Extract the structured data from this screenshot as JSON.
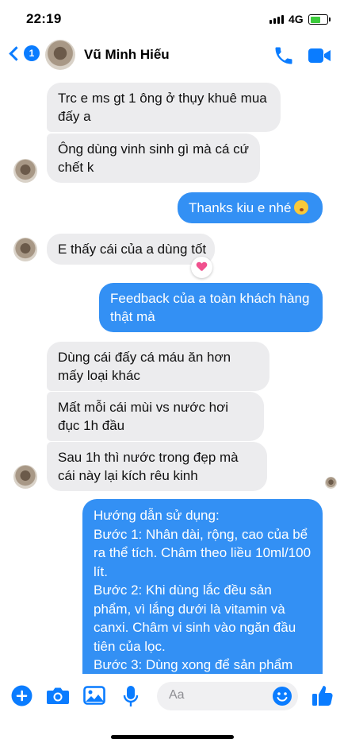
{
  "status": {
    "time": "22:19",
    "network": "4G"
  },
  "header": {
    "back_count": "1",
    "contact_name": "Vũ Minh Hiếu"
  },
  "messages": [
    {
      "dir": "in",
      "text": "Trc e ms gt 1 ông ở  thụy khuê mua đấy a"
    },
    {
      "dir": "in",
      "text": "Ông dùng vinh sinh gì mà cá cứ chết k"
    },
    {
      "dir": "out",
      "text": "Thanks kiu e nhé"
    },
    {
      "dir": "in",
      "text": "E thấy cái của a dùng tốt"
    },
    {
      "dir": "out",
      "text": "Feedback của a toàn khách hàng thật mà"
    },
    {
      "dir": "in",
      "text": "Dùng cái đấy cá máu ăn hơn mấy loại khác"
    },
    {
      "dir": "in",
      "text": "Mất mỗi cái mùi vs nước hơi đục 1h đầu"
    },
    {
      "dir": "in",
      "text": "Sau 1h thì nước trong đẹp mà cái này lại kích rêu kinh"
    },
    {
      "dir": "out",
      "lines": [
        "Hướng dẫn sử dụng:",
        "Bước 1: Nhân dài, rộng, cao của bể ra thể tích. Châm theo liều 10ml/100 lít.",
        "Bước 2: Khi dùng lắc đều sản phẩm, vì lắng dưới là vitamin và canxi. Châm vi sinh vào ngăn đầu tiên của lọc.",
        "Bước 3: Dùng xong để sản phẩm"
      ]
    }
  ],
  "reactions": {
    "heart": "heart-reaction"
  },
  "composer": {
    "placeholder": "Aa"
  },
  "colors": {
    "accent": "#0a7cff",
    "outgoing_bubble": "#3390f4",
    "incoming_bubble": "#ececee"
  }
}
